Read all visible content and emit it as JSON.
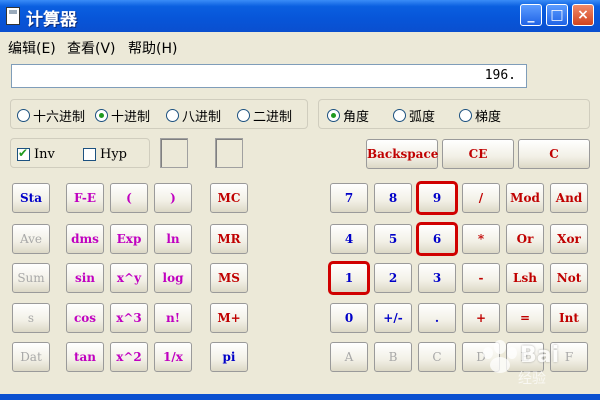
{
  "window": {
    "title": "计算器",
    "min": "_",
    "max": "□",
    "close": "×"
  },
  "menu": {
    "edit": "编辑(E)",
    "view": "查看(V)",
    "help": "帮助(H)"
  },
  "display": {
    "value": "196."
  },
  "base_options": {
    "hex": "十六进制",
    "dec": "十进制",
    "oct": "八进制",
    "bin": "二进制"
  },
  "angle_options": {
    "deg": "角度",
    "rad": "弧度",
    "grad": "梯度"
  },
  "checks": {
    "inv": "Inv",
    "hyp": "Hyp"
  },
  "buttons": {
    "backspace": "Backspace",
    "ce": "CE",
    "c": "C",
    "sta": "Sta",
    "ave": "Ave",
    "sum": "Sum",
    "s": "s",
    "dat": "Dat",
    "fe": "F-E",
    "dms": "dms",
    "sin": "sin",
    "cos": "cos",
    "tan": "tan",
    "lparen": "(",
    "exp": "Exp",
    "xpowy": "x^y",
    "xcube": "x^3",
    "xsq": "x^2",
    "rparen": ")",
    "ln": "ln",
    "log": "log",
    "fact": "n!",
    "recip": "1/x",
    "mc": "MC",
    "mr": "MR",
    "ms": "MS",
    "mplus": "M+",
    "pi": "pi",
    "d7": "7",
    "d8": "8",
    "d9": "9",
    "div": "/",
    "mod": "Mod",
    "and": "And",
    "d4": "4",
    "d5": "5",
    "d6": "6",
    "mul": "*",
    "or": "Or",
    "xor": "Xor",
    "d1": "1",
    "d2": "2",
    "d3": "3",
    "sub": "-",
    "lsh": "Lsh",
    "not": "Not",
    "d0": "0",
    "neg": "+/-",
    "dot": ".",
    "add": "+",
    "eq": "=",
    "int": "Int",
    "a": "A",
    "b": "B",
    "c_hex": "C",
    "d": "D",
    "e": "E",
    "f": "F"
  },
  "watermark": {
    "logo": "Bai",
    "text": "经验"
  },
  "colors": {
    "title_bar": "#0a5fe0",
    "highlight": "#d00000",
    "digit": "#0000c8",
    "operator": "#c00000",
    "function": "#c000c0"
  }
}
